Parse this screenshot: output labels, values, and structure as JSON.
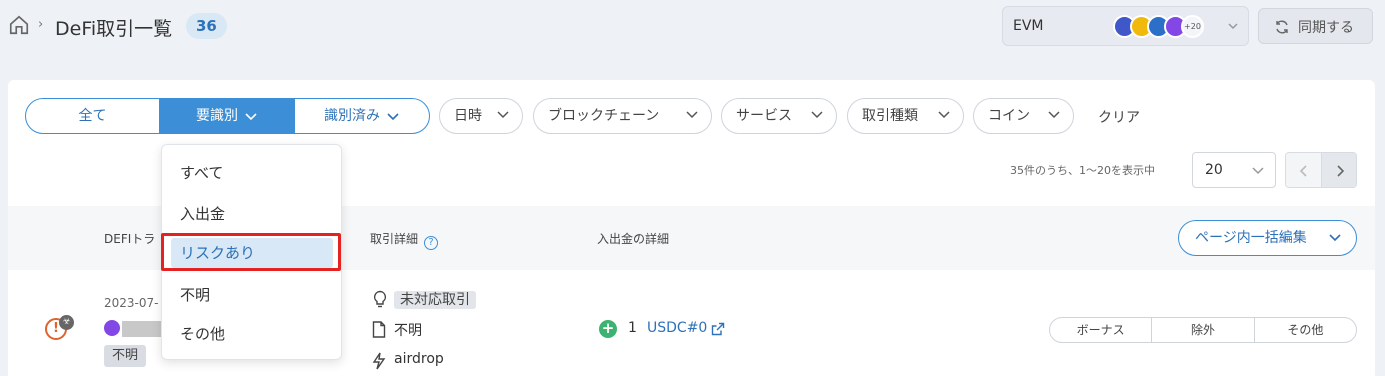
{
  "header": {
    "title": "DeFi取引一覧",
    "count": "36",
    "chain_select": {
      "label": "EVM",
      "more_badge": "+20"
    },
    "sync_label": "同期する"
  },
  "filters": {
    "segments": [
      "全て",
      "要識別",
      "識別済み"
    ],
    "pills": [
      "日時",
      "ブロックチェーン",
      "サービス",
      "取引種類",
      "コイン"
    ],
    "clear_label": "クリア"
  },
  "pagination": {
    "summary": "35件のうち、1〜20を表示中",
    "page_size": "20"
  },
  "table": {
    "headers": [
      "DEFIトラ",
      "取引詳細",
      "入出金の詳細"
    ],
    "bulk_edit_label": "ページ内一括編集",
    "rows": [
      {
        "date": "2023-07-",
        "badge": "不明",
        "status": "未対応取引",
        "type": "不明",
        "method": "airdrop",
        "amount": "1",
        "token": "USDC#0",
        "actions": [
          "ボーナス",
          "除外",
          "その他"
        ]
      }
    ]
  },
  "dropdown": {
    "items": [
      "すべて",
      "入出金",
      "リスクあり",
      "不明",
      "その他"
    ],
    "selected": "リスクあり"
  },
  "colors": {
    "accent": "#3c8fd6",
    "highlight": "#e52222",
    "warning": "#e0622d",
    "success": "#3cb371"
  }
}
